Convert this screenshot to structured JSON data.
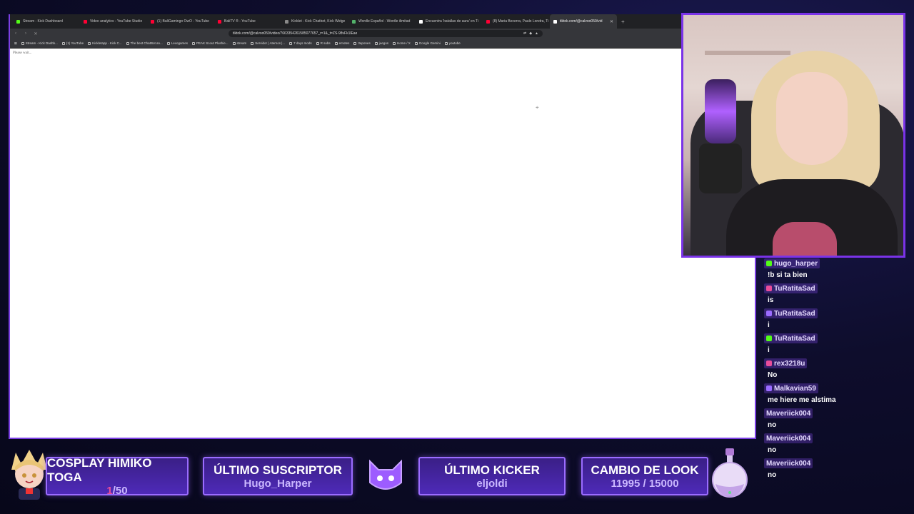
{
  "browser": {
    "tabs": [
      {
        "label": "Stream - Kick Dashboard",
        "color": "#53fc18"
      },
      {
        "label": "Video analytics - YouTube Studio",
        "color": "#ff0033"
      },
      {
        "label": "(1) BaliGamingo OwO - YouTube",
        "color": "#ff0033"
      },
      {
        "label": "BaliTV ® - YouTube",
        "color": "#ff0033"
      },
      {
        "label": "Kicklet - Kick Chatbot, Kick Widge",
        "color": "#8a8a8a"
      },
      {
        "label": "Wordle Español - Wordle ilimitad",
        "color": "#53b36b"
      },
      {
        "label": "Encuentra 'batallas de aura' en Ti",
        "color": "#ffffff"
      },
      {
        "label": "(8) Maria Becerra, Paulo Londra, Ti",
        "color": "#ff0033"
      },
      {
        "label": "tiktok.com/@calvoo059/vid",
        "color": "#ffffff",
        "active": true
      }
    ],
    "new_tab_label": "+",
    "url": "tiktok.com/@calvoo059/video/7663354261585077657_r=1&_t=ZS-98vFk1lEae",
    "bookmarks": [
      "Stream - Kick Dashb...",
      "(1) YouTube",
      "Kickletapp - Kick C...",
      "The best ChatBot an...",
      "Lexogames",
      "PEAK Scout Plushie...",
      "stream",
      "Servidor | Aternos |...",
      "7 days mods",
      "R subs",
      "emotes",
      "3apones",
      "juegos",
      "Home / X",
      "Google Gemini",
      "youtube"
    ],
    "page_text": "Please wait..."
  },
  "chat": {
    "messages": [
      {
        "user": "hugo_harper",
        "text": "!b si ta bien"
      },
      {
        "user": "TuRatitaSad",
        "text": "is"
      },
      {
        "user": "TuRatitaSad",
        "text": "i"
      },
      {
        "user": "TuRatitaSad",
        "text": "i"
      },
      {
        "user": "rex3218u",
        "text": "No"
      },
      {
        "user": "Malkavian59",
        "text": "me hiere me alstima"
      },
      {
        "user": "Maveriick004",
        "text": "no"
      },
      {
        "user": "Maveriick004",
        "text": "no"
      },
      {
        "user": "Maveriick004",
        "text": "no"
      }
    ]
  },
  "overlay": {
    "cosplay": {
      "title": "COSPLAY HIMIKO TOGA",
      "current": "1",
      "total": "/50"
    },
    "last_sub": {
      "title": "ÚLTIMO SUSCRIPTOR",
      "value": "Hugo_Harper"
    },
    "last_kicker": {
      "title": "ÚLTIMO KICKER",
      "value": "eljoldi"
    },
    "look_change": {
      "title": "CAMBIO DE LOOK",
      "value": "11995 / 15000"
    }
  },
  "colors": {
    "accent": "#7a33e8",
    "panel": "#4e2ab8",
    "highlight": "#e94d9a"
  }
}
